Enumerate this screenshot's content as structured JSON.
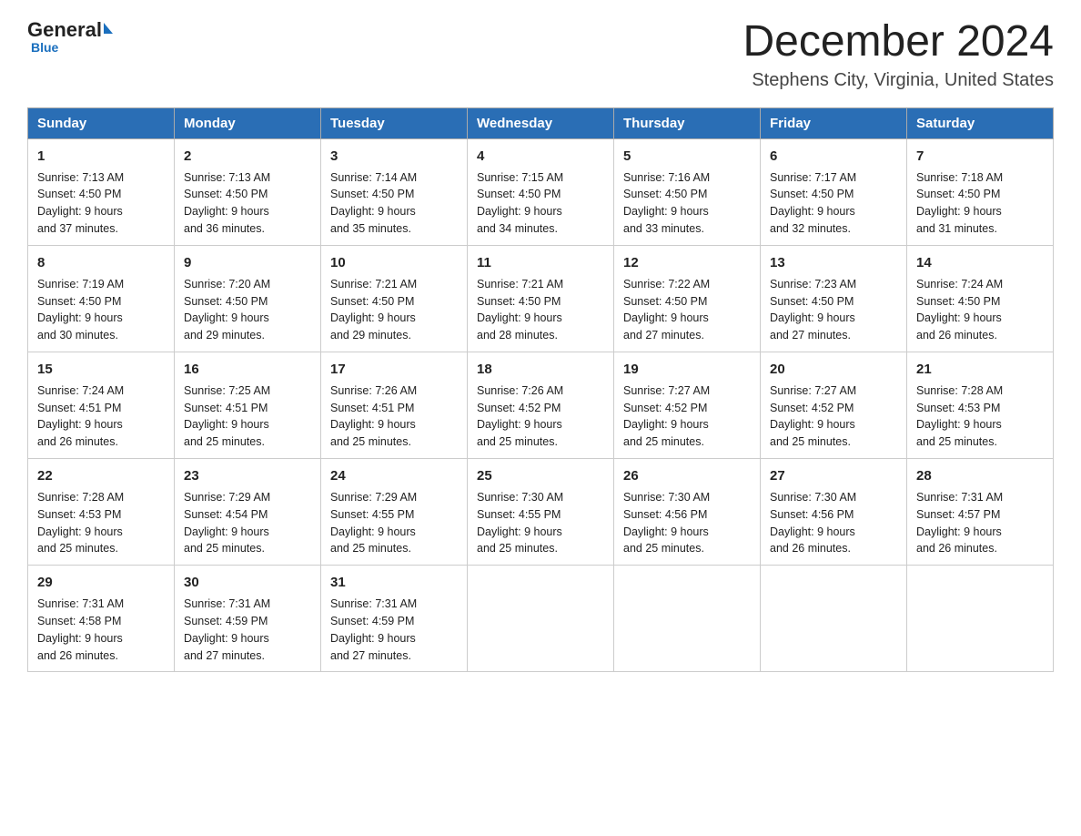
{
  "header": {
    "logo_general": "General",
    "logo_blue": "Blue",
    "month_title": "December 2024",
    "location": "Stephens City, Virginia, United States"
  },
  "weekdays": [
    "Sunday",
    "Monday",
    "Tuesday",
    "Wednesday",
    "Thursday",
    "Friday",
    "Saturday"
  ],
  "weeks": [
    [
      {
        "day": "1",
        "sunrise": "7:13 AM",
        "sunset": "4:50 PM",
        "daylight": "9 hours and 37 minutes."
      },
      {
        "day": "2",
        "sunrise": "7:13 AM",
        "sunset": "4:50 PM",
        "daylight": "9 hours and 36 minutes."
      },
      {
        "day": "3",
        "sunrise": "7:14 AM",
        "sunset": "4:50 PM",
        "daylight": "9 hours and 35 minutes."
      },
      {
        "day": "4",
        "sunrise": "7:15 AM",
        "sunset": "4:50 PM",
        "daylight": "9 hours and 34 minutes."
      },
      {
        "day": "5",
        "sunrise": "7:16 AM",
        "sunset": "4:50 PM",
        "daylight": "9 hours and 33 minutes."
      },
      {
        "day": "6",
        "sunrise": "7:17 AM",
        "sunset": "4:50 PM",
        "daylight": "9 hours and 32 minutes."
      },
      {
        "day": "7",
        "sunrise": "7:18 AM",
        "sunset": "4:50 PM",
        "daylight": "9 hours and 31 minutes."
      }
    ],
    [
      {
        "day": "8",
        "sunrise": "7:19 AM",
        "sunset": "4:50 PM",
        "daylight": "9 hours and 30 minutes."
      },
      {
        "day": "9",
        "sunrise": "7:20 AM",
        "sunset": "4:50 PM",
        "daylight": "9 hours and 29 minutes."
      },
      {
        "day": "10",
        "sunrise": "7:21 AM",
        "sunset": "4:50 PM",
        "daylight": "9 hours and 29 minutes."
      },
      {
        "day": "11",
        "sunrise": "7:21 AM",
        "sunset": "4:50 PM",
        "daylight": "9 hours and 28 minutes."
      },
      {
        "day": "12",
        "sunrise": "7:22 AM",
        "sunset": "4:50 PM",
        "daylight": "9 hours and 27 minutes."
      },
      {
        "day": "13",
        "sunrise": "7:23 AM",
        "sunset": "4:50 PM",
        "daylight": "9 hours and 27 minutes."
      },
      {
        "day": "14",
        "sunrise": "7:24 AM",
        "sunset": "4:50 PM",
        "daylight": "9 hours and 26 minutes."
      }
    ],
    [
      {
        "day": "15",
        "sunrise": "7:24 AM",
        "sunset": "4:51 PM",
        "daylight": "9 hours and 26 minutes."
      },
      {
        "day": "16",
        "sunrise": "7:25 AM",
        "sunset": "4:51 PM",
        "daylight": "9 hours and 25 minutes."
      },
      {
        "day": "17",
        "sunrise": "7:26 AM",
        "sunset": "4:51 PM",
        "daylight": "9 hours and 25 minutes."
      },
      {
        "day": "18",
        "sunrise": "7:26 AM",
        "sunset": "4:52 PM",
        "daylight": "9 hours and 25 minutes."
      },
      {
        "day": "19",
        "sunrise": "7:27 AM",
        "sunset": "4:52 PM",
        "daylight": "9 hours and 25 minutes."
      },
      {
        "day": "20",
        "sunrise": "7:27 AM",
        "sunset": "4:52 PM",
        "daylight": "9 hours and 25 minutes."
      },
      {
        "day": "21",
        "sunrise": "7:28 AM",
        "sunset": "4:53 PM",
        "daylight": "9 hours and 25 minutes."
      }
    ],
    [
      {
        "day": "22",
        "sunrise": "7:28 AM",
        "sunset": "4:53 PM",
        "daylight": "9 hours and 25 minutes."
      },
      {
        "day": "23",
        "sunrise": "7:29 AM",
        "sunset": "4:54 PM",
        "daylight": "9 hours and 25 minutes."
      },
      {
        "day": "24",
        "sunrise": "7:29 AM",
        "sunset": "4:55 PM",
        "daylight": "9 hours and 25 minutes."
      },
      {
        "day": "25",
        "sunrise": "7:30 AM",
        "sunset": "4:55 PM",
        "daylight": "9 hours and 25 minutes."
      },
      {
        "day": "26",
        "sunrise": "7:30 AM",
        "sunset": "4:56 PM",
        "daylight": "9 hours and 25 minutes."
      },
      {
        "day": "27",
        "sunrise": "7:30 AM",
        "sunset": "4:56 PM",
        "daylight": "9 hours and 26 minutes."
      },
      {
        "day": "28",
        "sunrise": "7:31 AM",
        "sunset": "4:57 PM",
        "daylight": "9 hours and 26 minutes."
      }
    ],
    [
      {
        "day": "29",
        "sunrise": "7:31 AM",
        "sunset": "4:58 PM",
        "daylight": "9 hours and 26 minutes."
      },
      {
        "day": "30",
        "sunrise": "7:31 AM",
        "sunset": "4:59 PM",
        "daylight": "9 hours and 27 minutes."
      },
      {
        "day": "31",
        "sunrise": "7:31 AM",
        "sunset": "4:59 PM",
        "daylight": "9 hours and 27 minutes."
      },
      null,
      null,
      null,
      null
    ]
  ]
}
